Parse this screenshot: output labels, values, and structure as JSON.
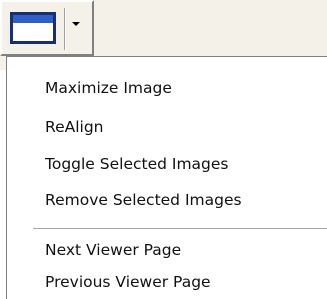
{
  "toolbar": {
    "view_button_icon": "window-icon",
    "dropdown_icon": "dropdown-arrow-icon"
  },
  "menu": {
    "items": [
      {
        "label": "Maximize Image"
      },
      {
        "label": "ReAlign"
      },
      {
        "label": "Toggle Selected Images"
      },
      {
        "label": "Remove Selected Images"
      },
      {
        "label": "Next Viewer Page"
      },
      {
        "label": "Previous Viewer Page"
      }
    ]
  }
}
